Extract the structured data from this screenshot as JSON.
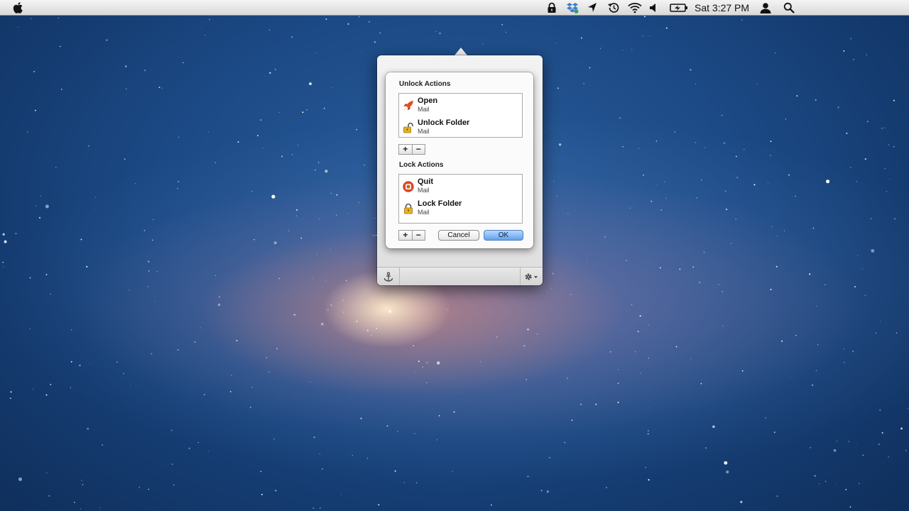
{
  "menubar": {
    "clock": "Sat 3:27 PM",
    "icons": [
      "apple-logo",
      "lock-icon",
      "dropbox-icon",
      "location-arrow-icon",
      "time-machine-icon",
      "wifi-icon",
      "volume-icon",
      "battery-charging-icon",
      "user-icon",
      "spotlight-search-icon"
    ]
  },
  "popover": {
    "unlock_section": {
      "title": "Unlock Actions",
      "items": [
        {
          "name": "Open",
          "sub": "Mail",
          "icon": "rocket-open-icon"
        },
        {
          "name": "Unlock Folder",
          "sub": "Mail",
          "icon": "unlocked-padlock-icon"
        }
      ]
    },
    "lock_section": {
      "title": "Lock Actions",
      "items": [
        {
          "name": "Quit",
          "sub": "Mail",
          "icon": "quit-stop-icon"
        },
        {
          "name": "Lock Folder",
          "sub": "Mail",
          "icon": "locked-padlock-icon"
        }
      ]
    },
    "buttons": {
      "add": "+",
      "remove": "−",
      "cancel": "Cancel",
      "ok": "OK"
    },
    "footer": {
      "left_icon": "anchor-icon",
      "right_icon": "gear-dropdown-icon"
    }
  },
  "colors": {
    "desktop_blue": "#1c4a86",
    "ok_button": "#5fa2ec",
    "quit_icon": "#e2501f",
    "padlock": "#e6b422"
  }
}
